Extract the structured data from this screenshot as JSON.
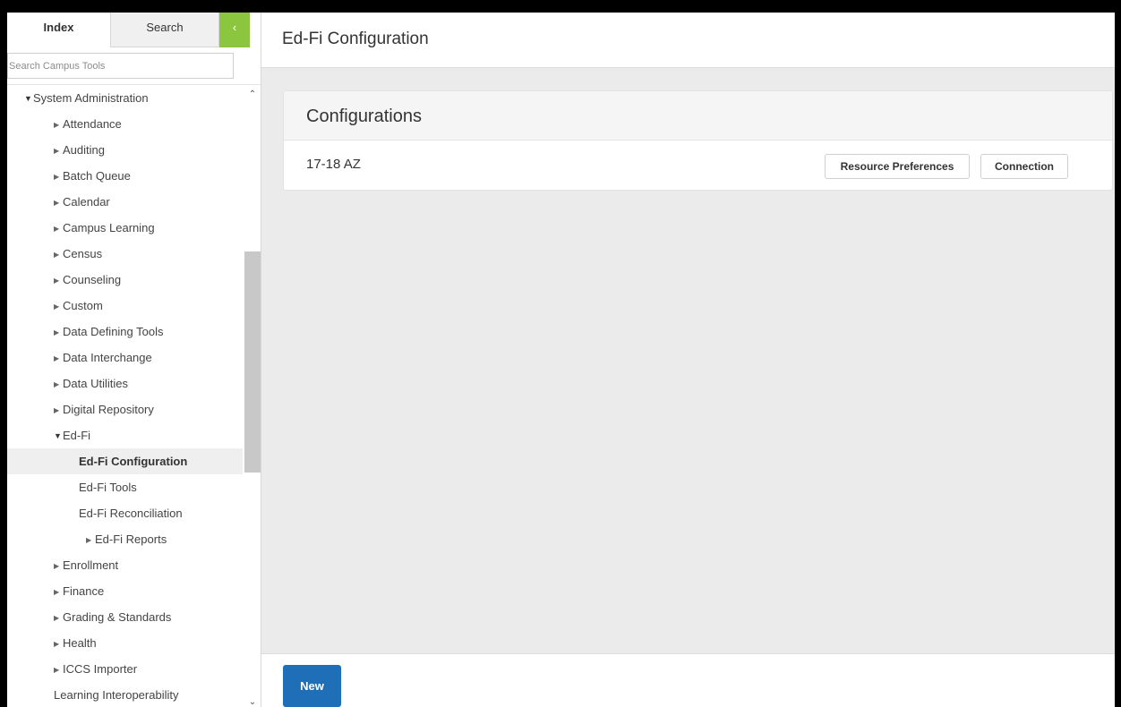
{
  "sidebar": {
    "tabs": {
      "index": "Index",
      "search": "Search",
      "collapse_glyph": "‹"
    },
    "search_placeholder": "Search Campus Tools",
    "tree": [
      {
        "label": "System Administration",
        "expanded": true
      },
      {
        "label": "Attendance"
      },
      {
        "label": "Auditing"
      },
      {
        "label": "Batch Queue"
      },
      {
        "label": "Calendar"
      },
      {
        "label": "Campus Learning"
      },
      {
        "label": "Census"
      },
      {
        "label": "Counseling"
      },
      {
        "label": "Custom"
      },
      {
        "label": "Data Defining Tools"
      },
      {
        "label": "Data Interchange"
      },
      {
        "label": "Data Utilities"
      },
      {
        "label": "Digital Repository"
      },
      {
        "label": "Ed-Fi",
        "expanded": true
      },
      {
        "label": "Ed-Fi Configuration",
        "active": true
      },
      {
        "label": "Ed-Fi Tools"
      },
      {
        "label": "Ed-Fi Reconciliation"
      },
      {
        "label": "Ed-Fi Reports"
      },
      {
        "label": "Enrollment"
      },
      {
        "label": "Finance"
      },
      {
        "label": "Grading & Standards"
      },
      {
        "label": "Health"
      },
      {
        "label": "ICCS Importer"
      },
      {
        "label": "Learning Interoperability"
      }
    ]
  },
  "main": {
    "title": "Ed-Fi Configuration",
    "card": {
      "title": "Configurations",
      "row_label": "17-18 AZ",
      "resource_button": "Resource Preferences",
      "connection_button": "Connection"
    },
    "new_button": "New"
  },
  "colors": {
    "accent_green": "#8cc63f",
    "primary_blue": "#1f6fb8"
  }
}
